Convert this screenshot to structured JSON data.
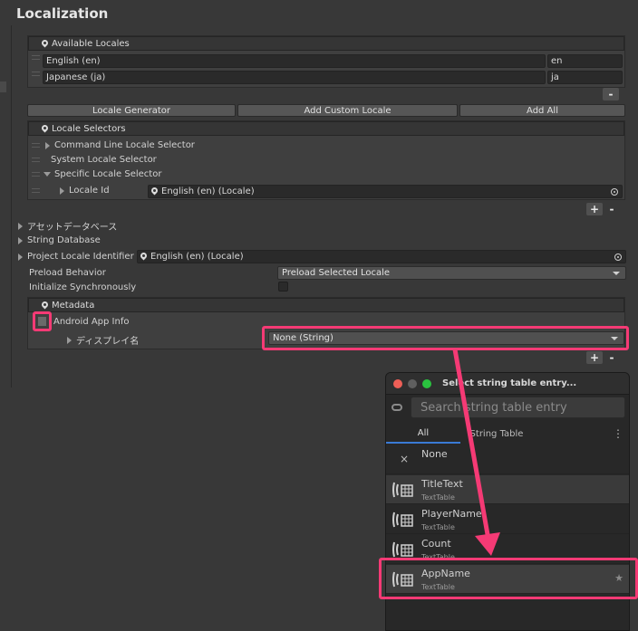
{
  "window": {
    "title": "Localization"
  },
  "available_locales": {
    "header": "Available Locales",
    "rows": [
      {
        "name": "English (en)",
        "code": "en"
      },
      {
        "name": "Japanese (ja)",
        "code": "ja"
      }
    ],
    "remove_label": "-"
  },
  "toolbar": {
    "locale_generator": "Locale Generator",
    "add_custom_locale": "Add Custom Locale",
    "add_all": "Add All"
  },
  "locale_selectors": {
    "header": "Locale Selectors",
    "items": [
      {
        "label": "Command Line Locale Selector"
      },
      {
        "label": "System Locale Selector"
      },
      {
        "label": "Specific Locale Selector"
      }
    ],
    "locale_id_label": "Locale Id",
    "locale_id_value": "English (en) (Locale)",
    "add_label": "+",
    "remove_label": "-"
  },
  "foldouts": {
    "asset_database": "アセットデータベース",
    "string_database": "String Database"
  },
  "settings": {
    "project_locale_label": "Project Locale Identifier",
    "project_locale_value": "English (en) (Locale)",
    "preload_label": "Preload Behavior",
    "preload_value": "Preload Selected Locale",
    "init_sync_label": "Initialize Synchronously"
  },
  "metadata": {
    "header": "Metadata",
    "entry_label": "Android App Info",
    "display_name_label": "ディスプレイ名",
    "display_name_value": "None (String)",
    "add_label": "+",
    "remove_label": "-"
  },
  "popup": {
    "title": "Select string table entry...",
    "search_placeholder": "Search string table entry",
    "tabs": [
      "All",
      "String Table"
    ],
    "menu_label": "⋮",
    "none_label": "None",
    "none_icon": "×",
    "entries": [
      {
        "name": "TitleText",
        "table": "TextTable"
      },
      {
        "name": "PlayerName",
        "table": "TextTable"
      },
      {
        "name": "Count",
        "table": "TextTable"
      },
      {
        "name": "AppName",
        "table": "TextTable"
      }
    ],
    "star": "★"
  },
  "colors": {
    "highlight": "#f53a75",
    "background": "#383838",
    "popup_bg": "#282828"
  }
}
